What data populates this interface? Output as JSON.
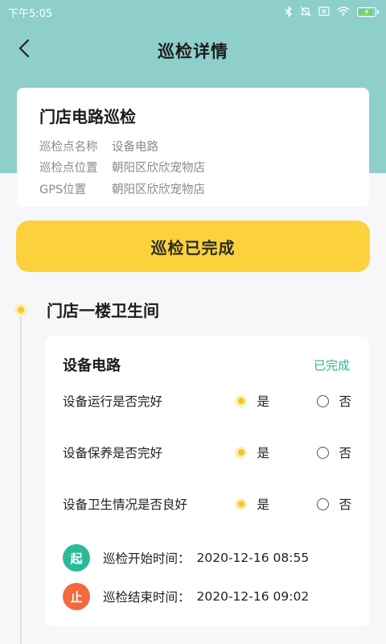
{
  "status_bar": {
    "time": "下午5:05",
    "icons": [
      "bluetooth-icon",
      "mute-icon",
      "sim-off-icon",
      "wifi-icon",
      "battery-charging-icon"
    ]
  },
  "header": {
    "title": "巡检详情",
    "back_icon": "chevron-left-icon"
  },
  "info_card": {
    "title": "门店电路巡检",
    "rows": [
      {
        "key": "巡检点名称",
        "value": "设备电路"
      },
      {
        "key": "巡检点位置",
        "value": "朝阳区欣欣宠物店"
      },
      {
        "key": "GPS位置",
        "value": "朝阳区欣欣宠物店"
      }
    ]
  },
  "status_button": {
    "label": "巡检已完成"
  },
  "timeline": {
    "location": "门店一楼卫生间",
    "card": {
      "title": "设备电路",
      "status": "已完成",
      "questions": [
        {
          "text": "设备运行是否完好",
          "yes": "是",
          "no": "否",
          "selected": "yes"
        },
        {
          "text": "设备保养是否完好",
          "yes": "是",
          "no": "否",
          "selected": "yes"
        },
        {
          "text": "设备卫生情况是否良好",
          "yes": "是",
          "no": "否",
          "selected": "yes"
        }
      ],
      "start": {
        "badge": "起",
        "label": "巡检开始时间：",
        "value": "2020-12-16 08:55"
      },
      "end": {
        "badge": "止",
        "label": "巡检结束时间：",
        "value": "2020-12-16 09:02"
      }
    }
  },
  "colors": {
    "header_bg": "#8ecfcc",
    "accent_yellow": "#fbd23c",
    "done_green": "#2cb99a",
    "start_badge": "#2cb99a",
    "end_badge": "#f26a3d"
  }
}
